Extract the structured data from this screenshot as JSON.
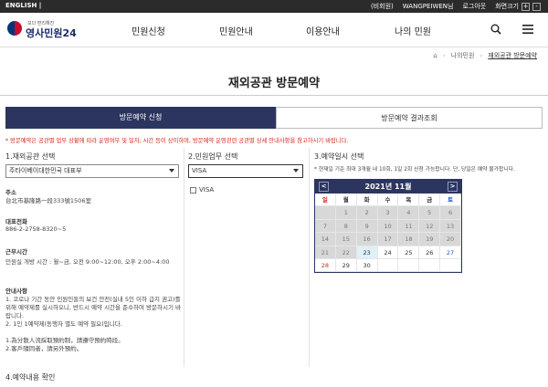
{
  "topbar": {
    "english": "ENGLISH |",
    "member_type": "(비회원)",
    "user": "WANGPEIWEN님",
    "logout": "로그아웃",
    "font_size": "화면크기",
    "plus": "+",
    "minus": "-"
  },
  "logo": {
    "tagline": "보다 편리해진",
    "name": "영사민원24"
  },
  "nav": [
    "민원신청",
    "민원안내",
    "이용안내",
    "나의 민원"
  ],
  "breadcrumb": {
    "home": "⌂",
    "level1": "나의민원",
    "current": "재외공관 방문예약"
  },
  "page_title": "재외공관 방문예약",
  "tabs": {
    "apply": "방문예약 신청",
    "result": "방문예약 결과조회"
  },
  "notice": "* 방문예약은 공관별 업무 상황에 따라 운영여부 및 일자, 시간 등이 상이하며, 방문예약 운영관련 공관별 상세 안내사항을 참고하시기 바랍니다.",
  "section1": {
    "title": "1.재외공관 선택",
    "selected": "주타이베이대한민국 대표부",
    "address_label": "주소",
    "address": "台北市基隆路一段333號1506室",
    "phone_label": "대표전화",
    "phone": "886-2-2758-8320~5",
    "hours_label": "근무시간",
    "hours": "민원실 개방 시간 : 월~금, 오전 9:00~12:00, 오후 2:00~4:00",
    "guide_label": "안내사항",
    "guide_lines": [
      "1. 코로나 기간 동안 민원인들의 보건 안전(실내 5인 이하 급지 권고)를",
      "위해 예약제를 실시하오니, 반드시 예약 시간을 준수하여 방문하시기 바",
      "랍니다.",
      "2. 1인 1예약제(동행자 별도 예약 필요)입니다.",
      "",
      "1.為分散人流採取預約制，請遵守預約時段。",
      "2.客戶隨同者，請另外預約。"
    ]
  },
  "section2": {
    "title": "2.민원업무 선택",
    "selected": "VISA",
    "checkbox_label": "VISA"
  },
  "section3": {
    "title": "3.예약일시 선택",
    "note": "* 현재일 기준 최대 3개월 내 10회, 1일 2회 신청 가능합니다. 단, 당일은 예약 불가합니다.",
    "month": "2021년 11월",
    "prev": "<",
    "next": ">",
    "weekdays": [
      "일",
      "월",
      "화",
      "수",
      "목",
      "금",
      "토"
    ],
    "weeks": [
      [
        "",
        "1",
        "2",
        "3",
        "4",
        "5",
        "6"
      ],
      [
        "7",
        "8",
        "9",
        "10",
        "11",
        "12",
        "13"
      ],
      [
        "14",
        "15",
        "16",
        "17",
        "18",
        "19",
        "20"
      ],
      [
        "21",
        "22",
        "23",
        "24",
        "25",
        "26",
        "27"
      ],
      [
        "28",
        "29",
        "30",
        "",
        "",
        "",
        ""
      ]
    ]
  },
  "section4": {
    "title": "4.예약내용 확인"
  }
}
